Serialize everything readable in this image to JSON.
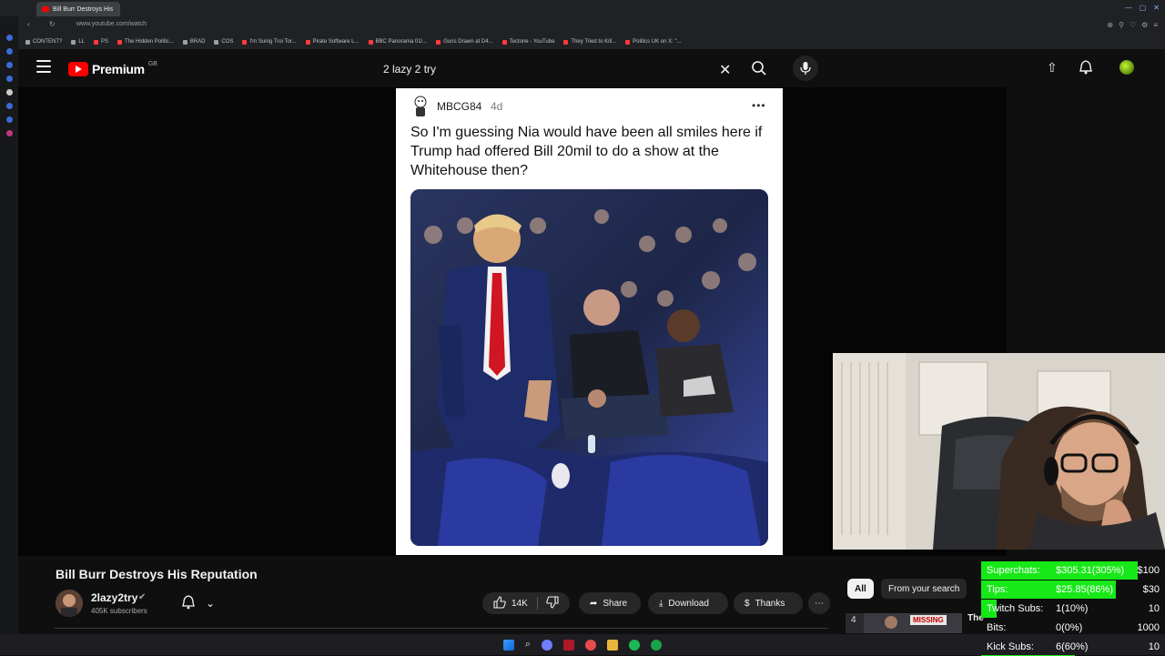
{
  "browser": {
    "tab_title": "Bill Burr Destroys His",
    "url": "www.youtube.com/watch",
    "bookmarks": [
      "CONTENT?",
      "LL",
      "PS",
      "The Hidden Politic...",
      "BRAD",
      "COS",
      "I'm Suing Troi Tor...",
      "Pirate Software L...",
      "BBC Panorama 01/...",
      "Guns Drawn at D4...",
      "Tectone - YouTube",
      "They Tried to Kill...",
      "Politics UK on X: \"..."
    ]
  },
  "header": {
    "logo_text": "Premium",
    "logo_region": "GB",
    "search_query": "2 lazy 2 try"
  },
  "post": {
    "username": "MBCG84",
    "age": "4d",
    "body": "So I'm guessing Nia would have been all smiles here if Trump had offered Bill 20mil to do a show at the Whitehouse then?"
  },
  "video": {
    "title": "Bill Burr Destroys His Reputation",
    "channel_name": "2lazy2try",
    "subscribers": "405K subscribers",
    "likes": "14K",
    "share_label": "Share",
    "download_label": "Download",
    "thanks_label": "Thanks"
  },
  "filters": {
    "all_label": "All",
    "from_search_label": "From your search"
  },
  "recommendation": {
    "badge": "MISSING",
    "title_fragment": "The",
    "number": "4"
  },
  "stats": [
    {
      "label": "Superchats:",
      "value": "$305.31(305%)",
      "goal": "$100",
      "fill": 1.0
    },
    {
      "label": "Tips:",
      "value": "$25.85(86%)",
      "goal": "$30",
      "fill": 0.86
    },
    {
      "label": "Twitch Subs:",
      "value": "1(10%)",
      "goal": "10",
      "fill": 0.1
    },
    {
      "label": "Bits:",
      "value": "0(0%)",
      "goal": "1000",
      "fill": 0.0
    },
    {
      "label": "Kick Subs:",
      "value": "6(60%)",
      "goal": "10",
      "fill": 0.6
    }
  ],
  "colors": {
    "brand_red": "#ff0000",
    "stats_green": "#17e817"
  }
}
